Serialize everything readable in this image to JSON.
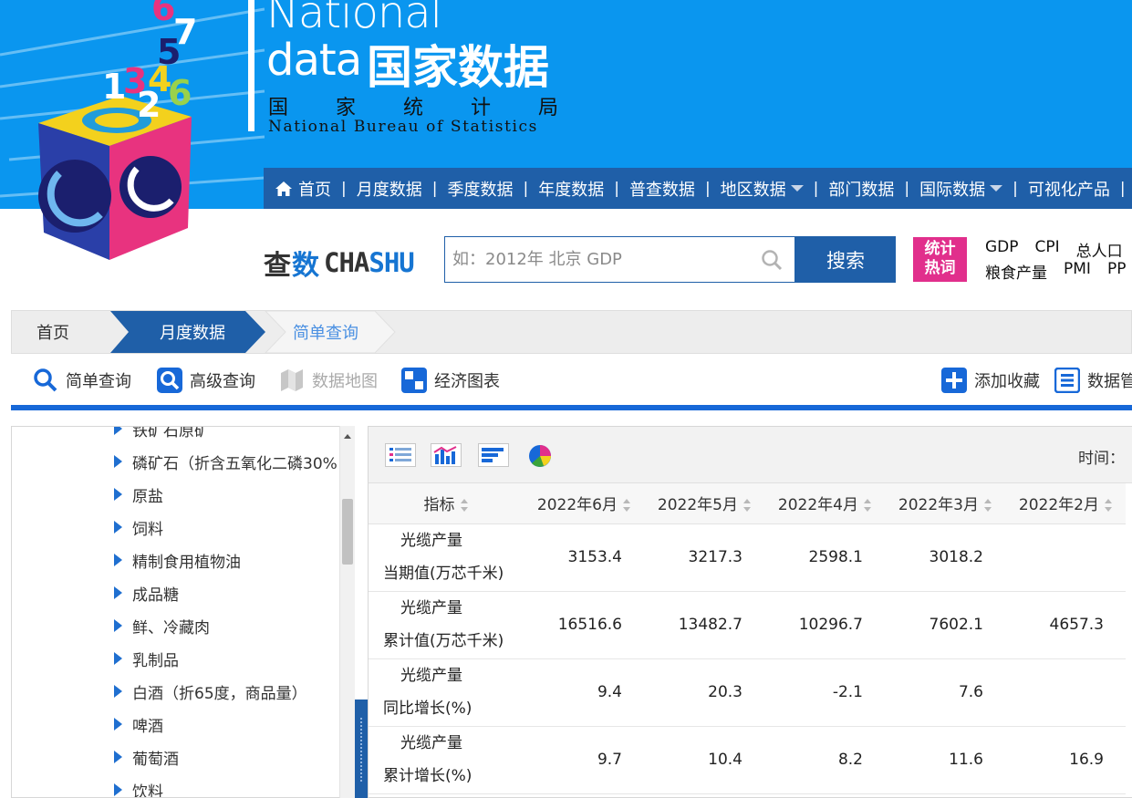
{
  "header": {
    "brand_en_line1": "National",
    "brand_en_line2": "data",
    "brand_cn": "国家数据",
    "org_cn_chars": [
      "国",
      "家",
      "统",
      "计",
      "局"
    ],
    "org_en": "National Bureau of Statistics",
    "logo_digits": [
      "6",
      "7",
      "5",
      "1",
      "3",
      "4",
      "6",
      "2"
    ],
    "colors": {
      "banner": "#0a96ef",
      "nav": "#1f5fa8",
      "hot_badge": "#e12f8c",
      "accent": "#1768d8"
    }
  },
  "nav": {
    "home_icon": "home-icon",
    "items": [
      {
        "label": "首页"
      },
      {
        "label": "月度数据"
      },
      {
        "label": "季度数据"
      },
      {
        "label": "年度数据"
      },
      {
        "label": "普查数据"
      },
      {
        "label": "地区数据",
        "dropdown": true
      },
      {
        "label": "部门数据"
      },
      {
        "label": "国际数据",
        "dropdown": true
      },
      {
        "label": "可视化产品"
      }
    ],
    "separator": "|"
  },
  "search": {
    "brand_cn_part1": "查",
    "brand_cn_part2": "数",
    "brand_en_part1": "CHA",
    "brand_en_part2": "SHU",
    "placeholder": "如：2012年 北京 GDP",
    "button_label": "搜索",
    "hot_badge_line1": "统计",
    "hot_badge_line2": "热词",
    "hot_row1": [
      "GDP",
      "CPI",
      "总人口"
    ],
    "hot_row2": [
      "粮食产量",
      "PMI",
      "PP"
    ]
  },
  "breadcrumb": {
    "home": "首页",
    "level1": "月度数据",
    "level2": "简单查询"
  },
  "tools": {
    "simple": "简单查询",
    "advanced": "高级查询",
    "map": "数据地图",
    "charts": "经济图表",
    "favorite": "添加收藏",
    "manage": "数据管"
  },
  "tree": {
    "items": [
      "铁矿石原矿",
      "磷矿石（折含五氧化二磷30%",
      "原盐",
      "饲料",
      "精制食用植物油",
      "成品糖",
      "鲜、冷藏肉",
      "乳制品",
      "白酒（折65度，商品量）",
      "啤酒",
      "葡萄酒",
      "饮料"
    ]
  },
  "table": {
    "time_label": "时间：",
    "headers": [
      "指标",
      "2022年6月",
      "2022年5月",
      "2022年4月",
      "2022年3月",
      "2022年2月"
    ],
    "rows": [
      {
        "name1": "光缆产量",
        "name2": "当期值(万芯千米)",
        "values": [
          "3153.4",
          "3217.3",
          "2598.1",
          "3018.2",
          ""
        ]
      },
      {
        "name1": "光缆产量",
        "name2": "累计值(万芯千米)",
        "values": [
          "16516.6",
          "13482.7",
          "10296.7",
          "7602.1",
          "4657.3"
        ]
      },
      {
        "name1": "光缆产量",
        "name2": "同比增长(%)",
        "values": [
          "9.4",
          "20.3",
          "-2.1",
          "7.6",
          ""
        ]
      },
      {
        "name1": "光缆产量",
        "name2": "累计增长(%)",
        "values": [
          "9.7",
          "10.4",
          "8.2",
          "11.6",
          "16.9"
        ]
      }
    ]
  }
}
